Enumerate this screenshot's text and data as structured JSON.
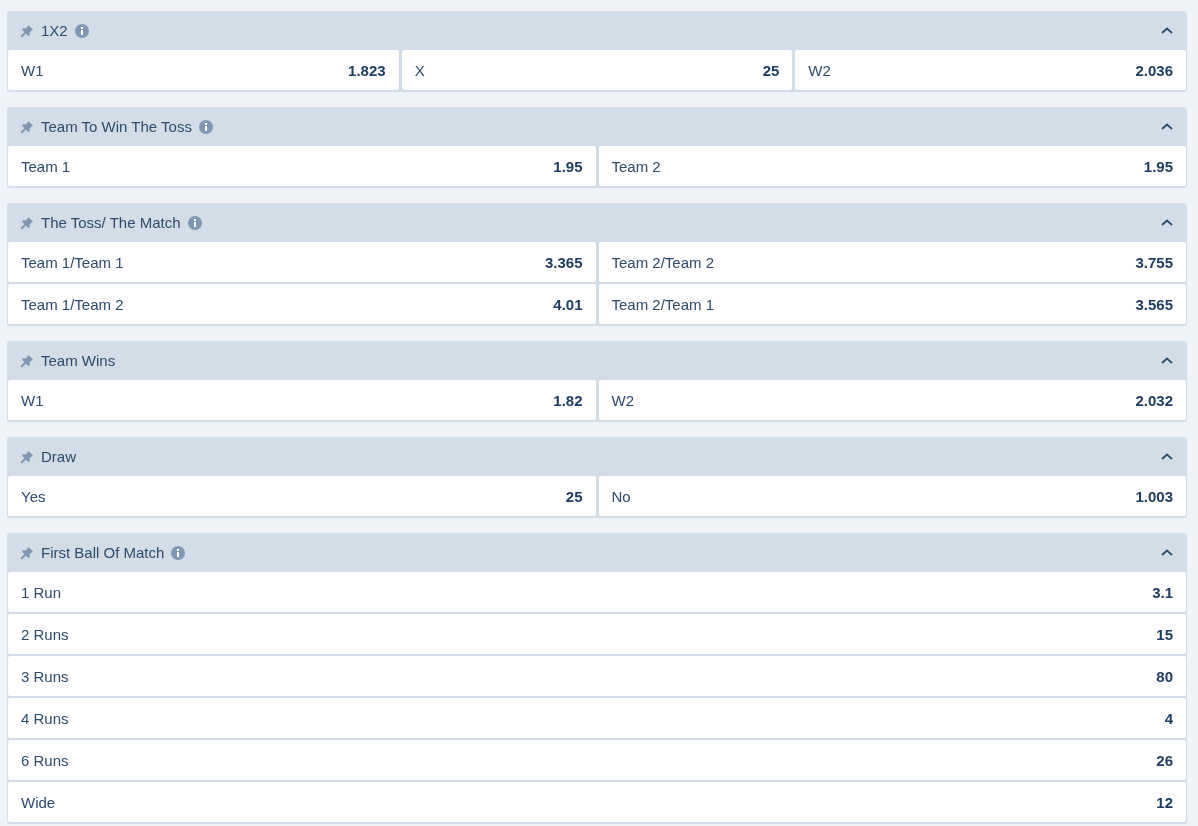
{
  "markets": [
    {
      "title": "1X2",
      "info": true,
      "expanded": true,
      "kind": "triple",
      "outcomes": [
        {
          "label": "W1",
          "odds": "1.823"
        },
        {
          "label": "X",
          "odds": "25"
        },
        {
          "label": "W2",
          "odds": "2.036"
        }
      ]
    },
    {
      "title": "Team To Win The Toss",
      "info": true,
      "expanded": true,
      "kind": "pair",
      "outcomes": [
        {
          "label": "Team 1",
          "odds": "1.95"
        },
        {
          "label": "Team 2",
          "odds": "1.95"
        }
      ]
    },
    {
      "title": "The Toss/ The Match",
      "info": true,
      "expanded": true,
      "kind": "pair",
      "outcomes": [
        {
          "label": "Team 1/Team 1",
          "odds": "3.365"
        },
        {
          "label": "Team 2/Team 2",
          "odds": "3.755"
        },
        {
          "label": "Team 1/Team 2",
          "odds": "4.01"
        },
        {
          "label": "Team 2/Team 1",
          "odds": "3.565"
        }
      ]
    },
    {
      "title": "Team Wins",
      "info": false,
      "expanded": true,
      "kind": "pair",
      "outcomes": [
        {
          "label": "W1",
          "odds": "1.82"
        },
        {
          "label": "W2",
          "odds": "2.032"
        }
      ]
    },
    {
      "title": "Draw",
      "info": false,
      "expanded": true,
      "kind": "pair",
      "outcomes": [
        {
          "label": "Yes",
          "odds": "25"
        },
        {
          "label": "No",
          "odds": "1.003"
        }
      ]
    },
    {
      "title": "First Ball Of Match",
      "info": true,
      "expanded": true,
      "kind": "list",
      "outcomes": [
        {
          "label": "1 Run",
          "odds": "3.1"
        },
        {
          "label": "2 Runs",
          "odds": "15"
        },
        {
          "label": "3 Runs",
          "odds": "80"
        },
        {
          "label": "4 Runs",
          "odds": "4"
        },
        {
          "label": "6 Runs",
          "odds": "26"
        },
        {
          "label": "Wide",
          "odds": "12"
        }
      ]
    }
  ]
}
